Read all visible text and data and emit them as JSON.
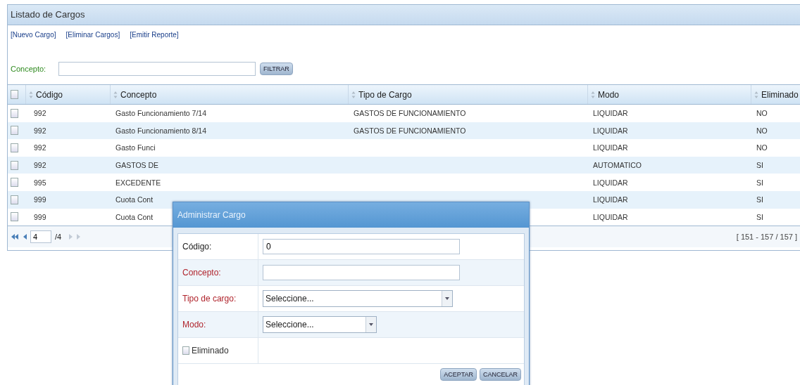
{
  "panel": {
    "title": "Listado de Cargos"
  },
  "links": [
    "[Nuevo Cargo]",
    "[Eliminar Cargos]",
    "[Emitir Reporte]"
  ],
  "filter": {
    "label": "Concepto:",
    "button": "FILTRAR"
  },
  "table": {
    "header_checkbox": {
      "checked": false
    },
    "columns": [
      {
        "label": "Código",
        "sortable": true
      },
      {
        "label": "Concepto",
        "sortable": true
      },
      {
        "label": "Tipo de Cargo",
        "sortable": true
      },
      {
        "label": "Modo",
        "sortable": true
      },
      {
        "label": "Eliminado",
        "sortable": true
      }
    ],
    "rows": [
      {
        "checked": false,
        "cells": [
          "992",
          "Gasto Funcionamiento 7/14",
          "GASTOS DE FUNCIONAMIENTO",
          "LIQUIDAR",
          "NO"
        ]
      },
      {
        "checked": false,
        "cells": [
          "992",
          "Gasto Funcionamiento 8/14",
          "GASTOS DE FUNCIONAMIENTO",
          "LIQUIDAR",
          "NO"
        ]
      },
      {
        "checked": false,
        "cells": [
          "992",
          "Gasto Funci",
          null,
          "LIQUIDAR",
          "NO"
        ]
      },
      {
        "checked": false,
        "cells": [
          "992",
          "GASTOS DE",
          null,
          "AUTOMATICO",
          "SI"
        ]
      },
      {
        "checked": false,
        "cells": [
          "995",
          "EXCEDENTE",
          null,
          "LIQUIDAR",
          "SI"
        ]
      },
      {
        "checked": false,
        "cells": [
          "999",
          "Cuota Cont",
          null,
          "LIQUIDAR",
          "SI"
        ]
      },
      {
        "checked": false,
        "cells": [
          "999",
          "Cuota Cont",
          null,
          "LIQUIDAR",
          "SI"
        ]
      }
    ]
  },
  "pager": {
    "page": "4",
    "total": "/4",
    "range": "[ 151 - 157 / 157 ]"
  },
  "dialog": {
    "title": "Administrar Cargo",
    "fields": [
      {
        "kind": "text",
        "label": "Código:",
        "required": false,
        "value": "0"
      },
      {
        "kind": "text",
        "label": "Concepto:",
        "required": true
      },
      {
        "kind": "select",
        "label": "Tipo de cargo:",
        "required": true,
        "value": "Seleccione...",
        "wide": true
      },
      {
        "kind": "select",
        "label": "Modo:",
        "required": true,
        "value": "Seleccione...",
        "wide": false
      },
      {
        "kind": "checkbox",
        "label": "Eliminado",
        "checked": false
      }
    ],
    "buttons": [
      "ACEPTAR",
      "CANCELAR"
    ]
  }
}
